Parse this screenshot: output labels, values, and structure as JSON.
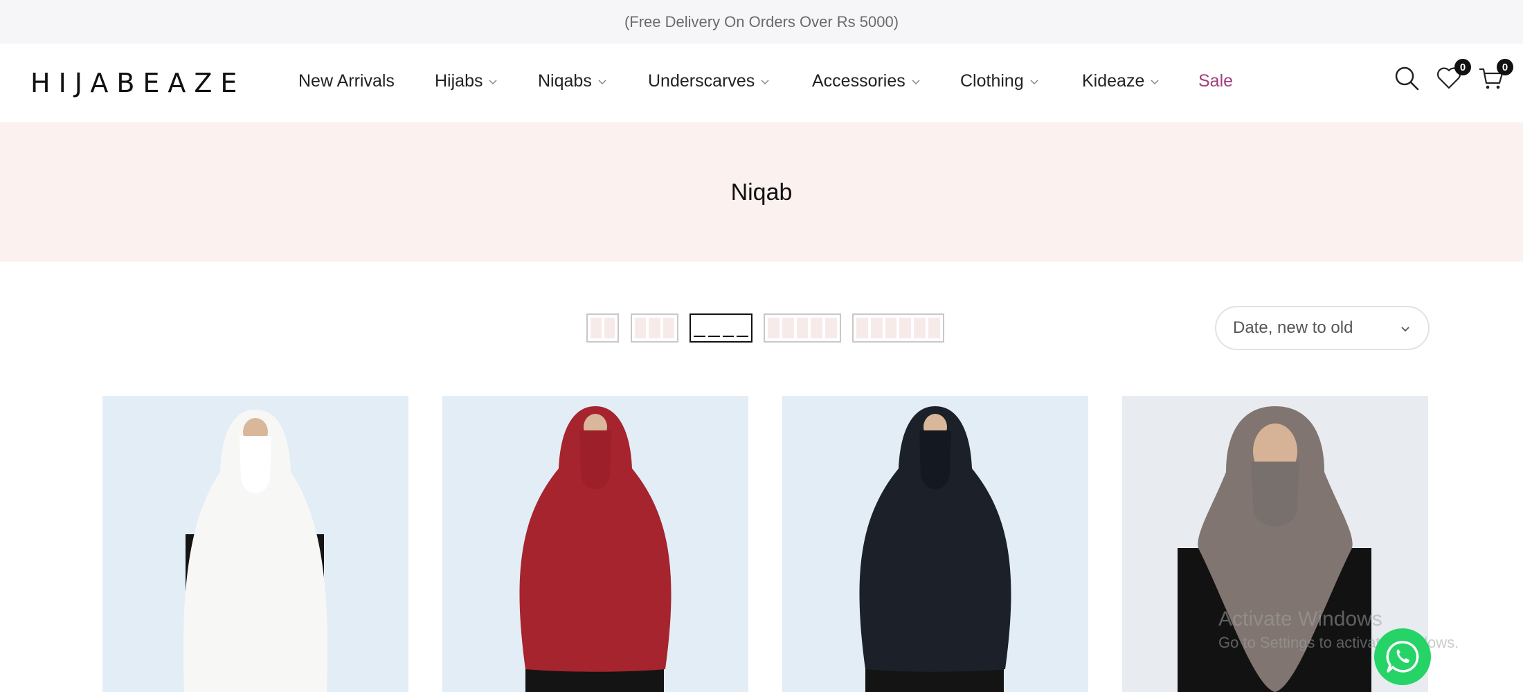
{
  "announcement": "(Free Delivery On Orders Over Rs 5000)",
  "logo": "HIJABEAZE",
  "nav": [
    {
      "label": "New Arrivals",
      "dropdown": false
    },
    {
      "label": "Hijabs",
      "dropdown": true
    },
    {
      "label": "Niqabs",
      "dropdown": true
    },
    {
      "label": "Underscarves",
      "dropdown": true
    },
    {
      "label": "Accessories",
      "dropdown": true
    },
    {
      "label": "Clothing",
      "dropdown": true
    },
    {
      "label": "Kideaze",
      "dropdown": true
    },
    {
      "label": "Sale",
      "dropdown": false,
      "color": "#a0407b"
    }
  ],
  "header_icons": {
    "search": "search-icon",
    "wishlist": {
      "icon": "heart-icon",
      "count": "0"
    },
    "cart": {
      "icon": "cart-icon",
      "count": "0"
    }
  },
  "page_title": "Niqab",
  "layout_options": [
    {
      "columns": 2,
      "active": false
    },
    {
      "columns": 3,
      "active": false
    },
    {
      "columns": 4,
      "active": true
    },
    {
      "columns": 5,
      "active": false
    },
    {
      "columns": 6,
      "active": false
    }
  ],
  "sort": {
    "selected": "Date, new to old"
  },
  "products": [
    {
      "garment_color": "#f7f8f6",
      "face_veil_color": "#ffffff"
    },
    {
      "garment_color": "#a5242e",
      "face_veil_color": "#9c1f29"
    },
    {
      "garment_color": "#1c2029",
      "face_veil_color": "#141821"
    },
    {
      "garment_color": "#807570",
      "face_veil_color": "#77706c"
    }
  ],
  "watermark": {
    "line1": "Activate Windows",
    "line2": "Go to Settings to activate Windows."
  },
  "colors": {
    "accent": "#a0407b",
    "hero_bg": "#fbf1ef",
    "announcement_bg": "#f6f6f8",
    "whatsapp": "#25d366"
  }
}
